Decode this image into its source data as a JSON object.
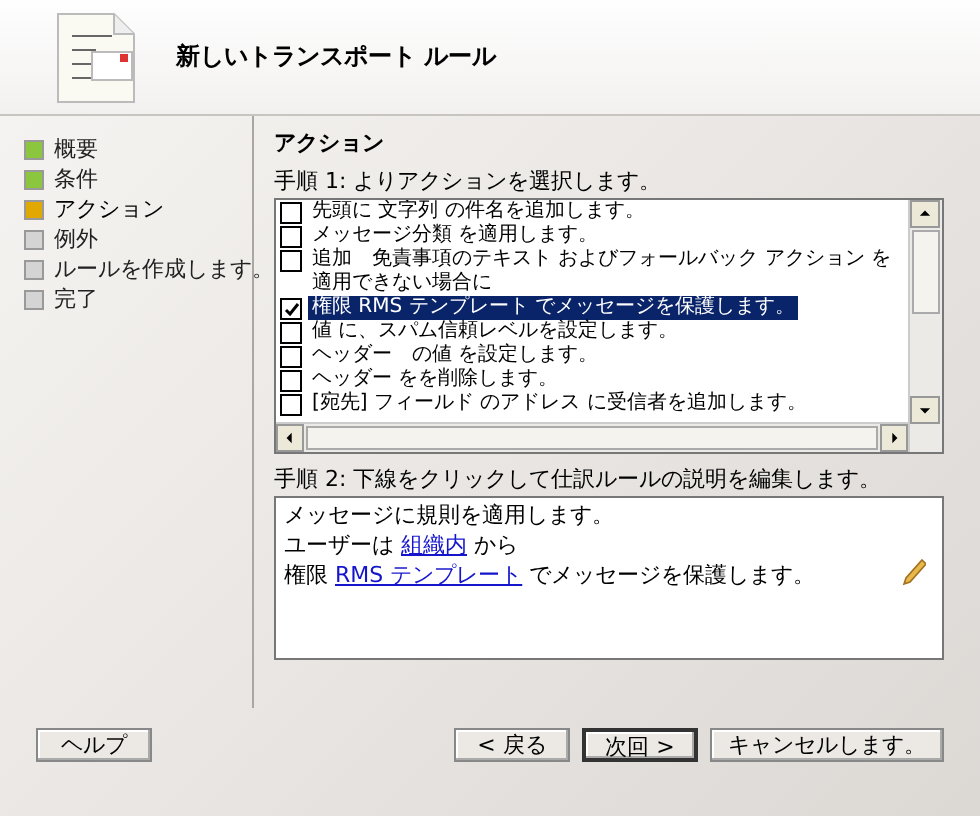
{
  "header": {
    "title": "新しいトランスポート ルール"
  },
  "nav": [
    {
      "label": "概要",
      "color": "#8cc63f",
      "selected": false
    },
    {
      "label": "条件",
      "color": "#8cc63f",
      "selected": false
    },
    {
      "label": "アクション",
      "color": "#e0a800",
      "selected": true
    },
    {
      "label": "例外",
      "color": "#d4d4d4",
      "selected": false
    },
    {
      "label": "ルールを作成します。",
      "color": "#d4d4d4",
      "selected": false
    },
    {
      "label": "完了",
      "color": "#d4d4d4",
      "selected": false
    }
  ],
  "section_title": "アクション",
  "step1": {
    "label": "手順 1: よりアクションを選択します。",
    "items": [
      {
        "text": "先頭に 文字列 の件名を追加します。",
        "checked": false,
        "selected": false
      },
      {
        "text": "メッセージ分類 を適用します。",
        "checked": false,
        "selected": false
      },
      {
        "text": "追加　免責事項のテキスト およびフォールバック アクション を適用できない場合に",
        "checked": false,
        "selected": false
      },
      {
        "text": "権限 RMS テンプレート でメッセージを保護します。",
        "checked": true,
        "selected": true
      },
      {
        "text": "値 に、スパム信頼レベルを設定します。",
        "checked": false,
        "selected": false
      },
      {
        "text": "ヘッダー　の値 を設定します。",
        "checked": false,
        "selected": false
      },
      {
        "text": "ヘッダー をを削除します。",
        "checked": false,
        "selected": false
      },
      {
        "text": "[宛先] フィールド のアドレス に受信者を追加します。",
        "checked": false,
        "selected": false
      }
    ]
  },
  "step2": {
    "label": "手順 2: 下線をクリックして仕訳ルールの説明を編集します。",
    "lines": [
      {
        "text": "メッセージに規則を適用します。"
      },
      {
        "text": "ユーザーは ",
        "link": "組織内",
        "after": " から"
      },
      {
        "text": "権限 ",
        "link": "RMS テンプレート",
        "after": " でメッセージを保護します。"
      }
    ]
  },
  "buttons": [
    {
      "label": "ヘルプ",
      "default": false
    },
    {
      "label": "< 戻る",
      "default": false
    },
    {
      "label": "次回 >",
      "default": true
    },
    {
      "label": "キャンセルします。",
      "default": false
    }
  ]
}
